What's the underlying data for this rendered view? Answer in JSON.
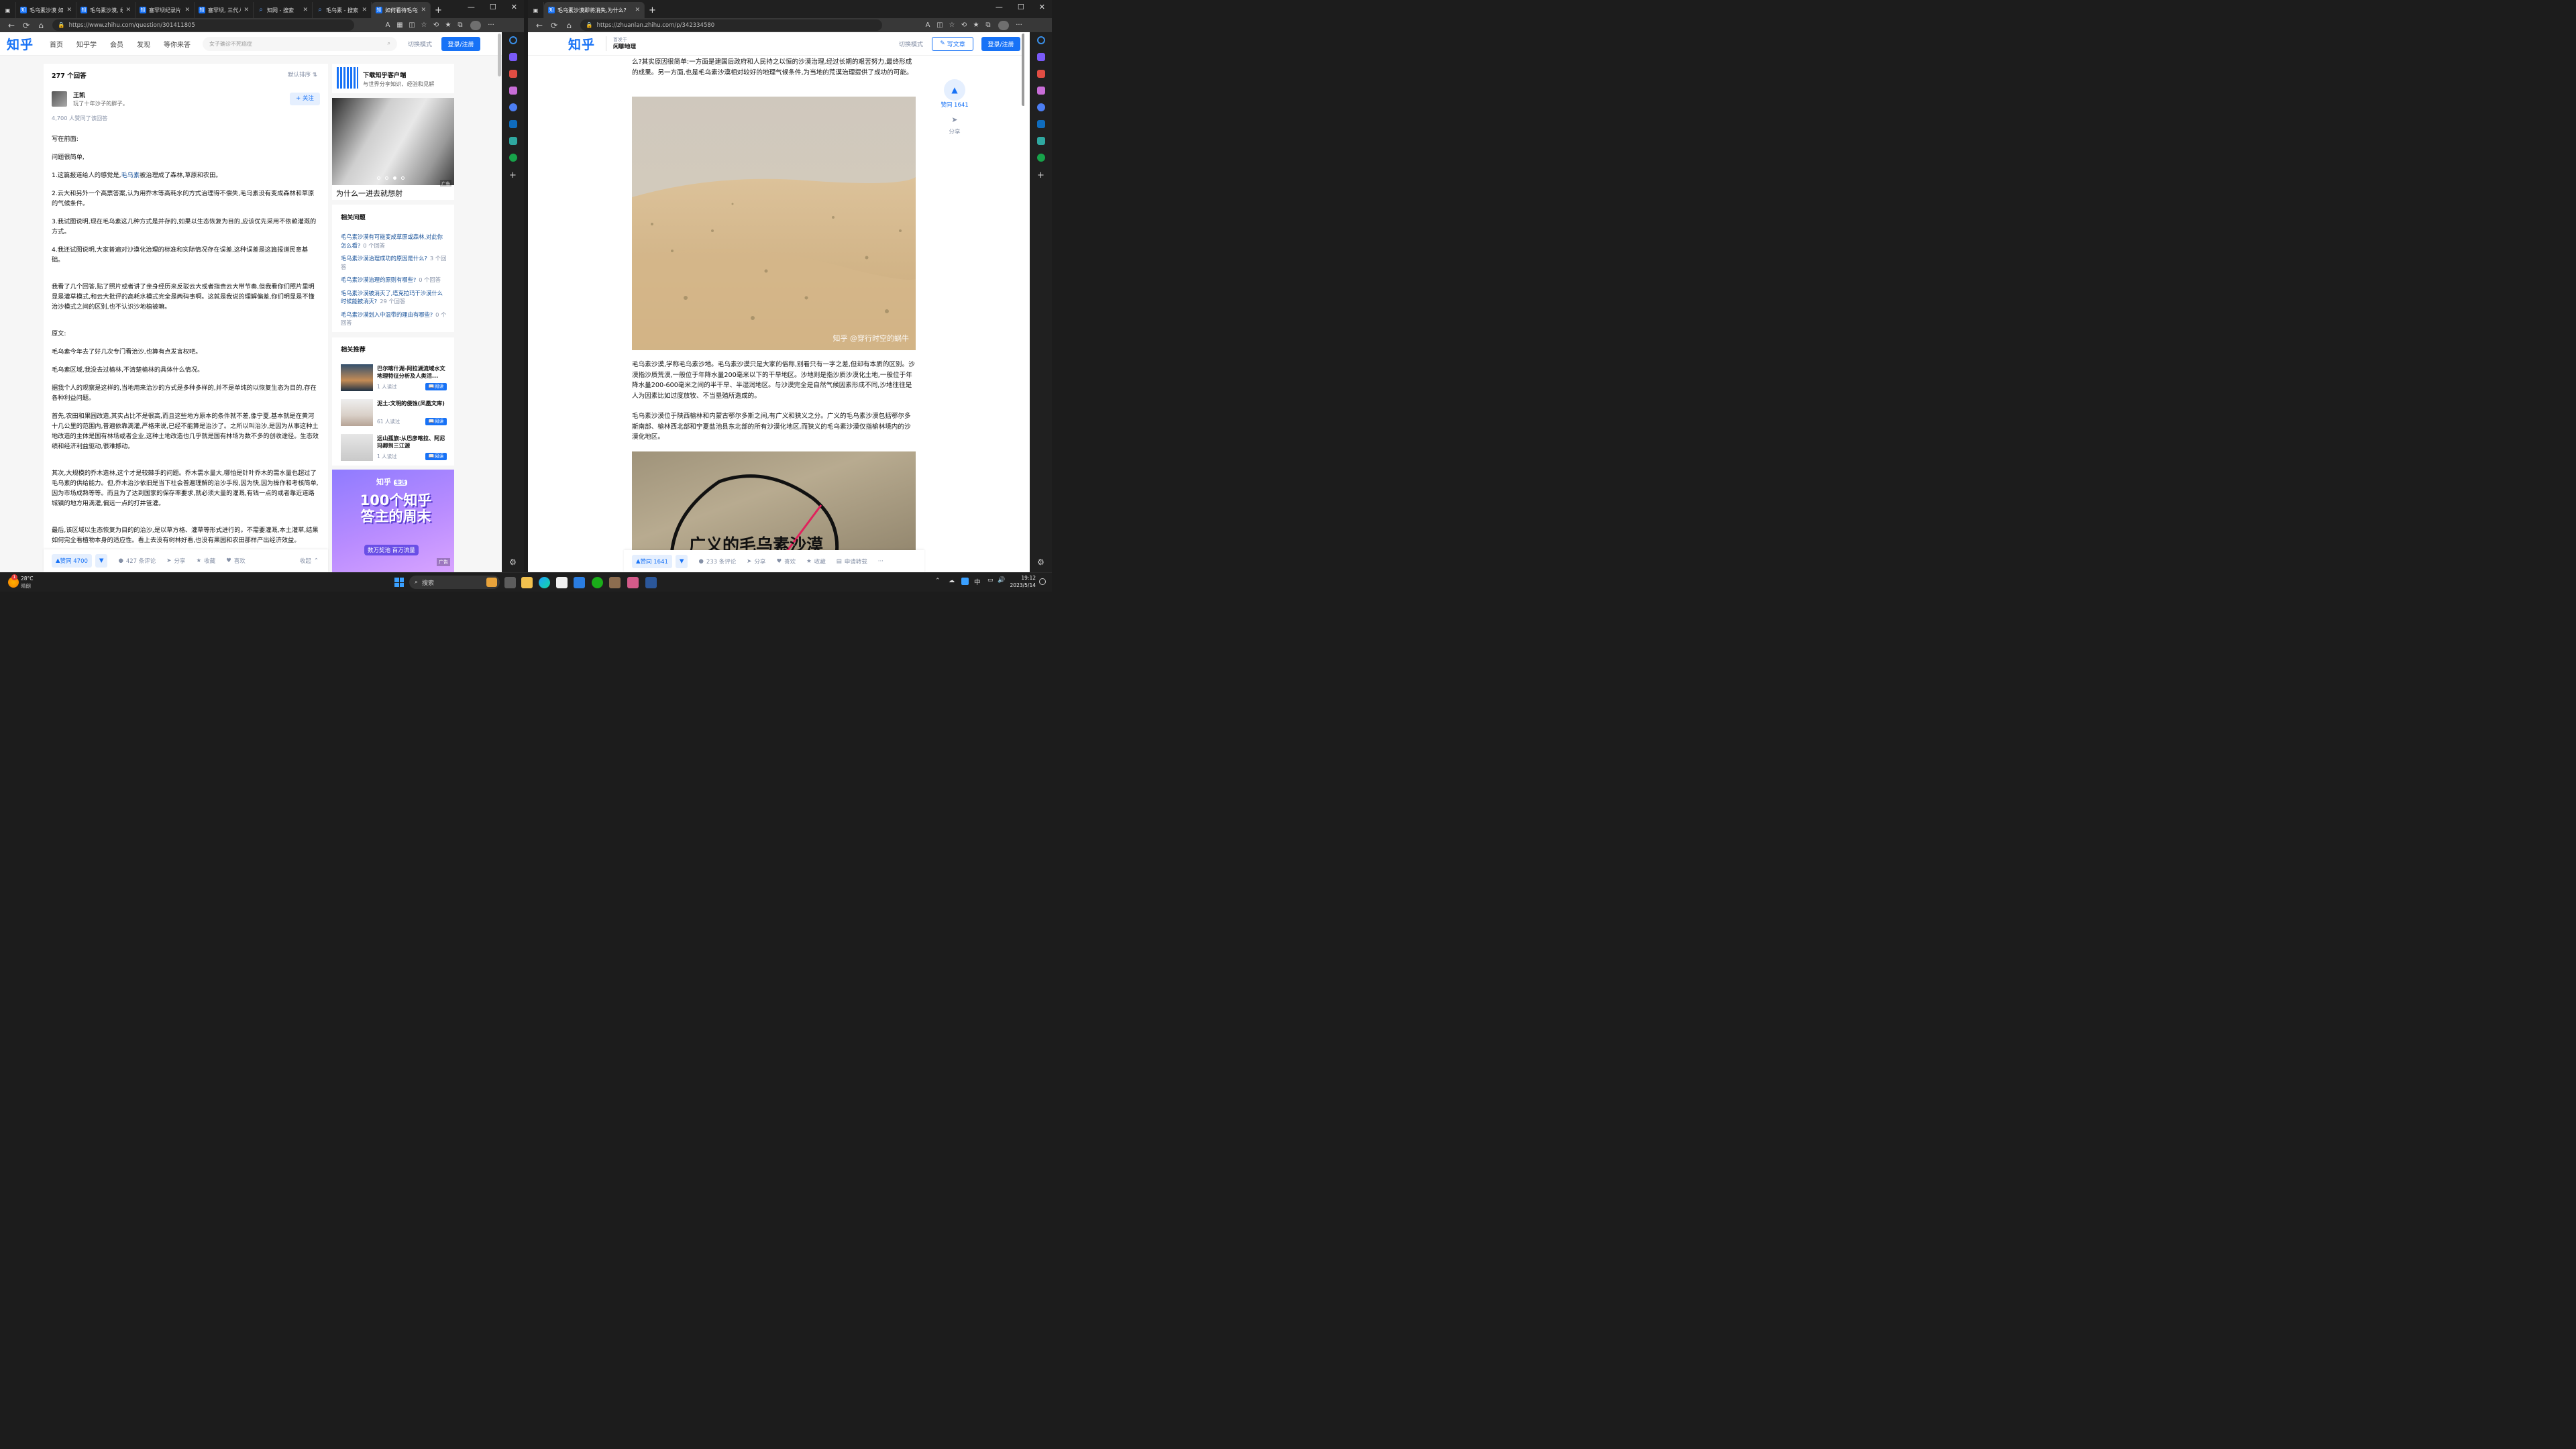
{
  "left": {
    "tabs": [
      {
        "label": "毛乌素沙漠 如何",
        "icon": "知"
      },
      {
        "label": "毛乌素沙漠, 经",
        "icon": "知"
      },
      {
        "label": "塞罕坝纪录片 -",
        "icon": "知"
      },
      {
        "label": "塞罕坝, 三代人",
        "icon": "知"
      },
      {
        "label": "知网 - 搜索",
        "icon": "search"
      },
      {
        "label": "毛乌素 - 搜索",
        "icon": "search"
      },
      {
        "label": "如何看待毛乌素",
        "icon": "知"
      }
    ],
    "url": "https://www.zhihu.com/question/301411805",
    "logo": "知乎",
    "nav": [
      "首页",
      "知乎学",
      "会员",
      "发现",
      "等你来答"
    ],
    "search_placeholder": "女子确诊不死癌症",
    "switch_mode": "切换模式",
    "login": "登录/注册",
    "answer_count": "277 个回答",
    "sort": "默认排序",
    "author": {
      "name": "王凯",
      "bio": "玩了十年沙子的胖子。",
      "follow": "关注"
    },
    "agree_line": "4,700 人赞同了该回答",
    "paragraphs": [
      {
        "text": "写在前面:"
      },
      {
        "text": "问题很简单,"
      },
      {
        "pre": "1.这篇报道给人的感觉是,",
        "link": "毛乌素",
        "post": "被治理成了森林,草原和农田。"
      },
      {
        "text": "2.云大和另外一个高票答案,认为用乔木等高耗水的方式治理得不偿失,毛乌素没有变成森林和草原的气候条件。"
      },
      {
        "text": "3.我试图说明,现在毛乌素这几种方式是并存的,如果以生态恢复为目的,应该优先采用不依赖灌溉的方式。"
      },
      {
        "text": "4.我还试图说明,大家普遍对沙漠化治理的标准和实际情况存在误差,这种误差是这篇报道民意基础。"
      },
      {
        "text": "我看了几个回答,贴了照片或者讲了亲身经历来反驳云大或者指责云大带节奏,但我看你们照片里明显是灌草模式,和云大批评的高耗水模式完全是两码事啊。这就是我说的理解偏差,你们明显是不懂治沙模式之间的区别,也不认识沙地植被嘛。"
      },
      {
        "text": "原文:"
      },
      {
        "text": "毛乌素今年去了好几次专门看治沙,也算有点发言权吧。"
      },
      {
        "text": "毛乌素区域,我没去过榆林,不清楚榆林的具体什么情况。"
      },
      {
        "text": "据我个人的观察是这样的,当地用来治沙的方式是多种多样的,并不是单纯的以恢复生态为目的,存在各种利益问题。"
      },
      {
        "text": "首先,农田和果园改造,其实占比不是很高,而且这些地方原本的条件就不差,像宁夏,基本就是在黄河十几公里的范围内,普遍依靠滴灌,严格来说,已经不能算是治沙了。之所以叫治沙,是因为从事这种土地改造的主体是国有林场或者企业,这种土地改造也几乎就是国有林场为数不多的创收途径。生态效绩和经济利益驱动,很难撼动。"
      },
      {
        "text": "其次,大规模的乔木造林,这个才是较棘手的问题。乔木需水量大,哪怕是针叶乔木的需水量也超过了毛乌素的供给能力。但,乔木治沙依旧是当下社会普遍理解的治沙手段,因为快,因为操作和考核简单,因为市场成熟等等。而且为了达到国家的保存率要求,就必须大量的灌溉,有钱一点的或者靠近道路城镇的地方用滴灌,偏远一点的打井管灌。"
      },
      {
        "text": "最后,该区域以生态恢复为目的的治沙,是以草方格、灌草等形式进行的。不需要灌溉,本土灌草,结果如何完全看植物本身的适应性。看上去没有树林好看,也没有果园和农田那样产出经济效益。"
      }
    ],
    "actions": {
      "vote": "赞同 4700",
      "comments": "427 条评论",
      "share": "分享",
      "favorite": "收藏",
      "like": "喜欢",
      "collapse": "收起"
    },
    "app_card": {
      "title": "下载知乎客户端",
      "sub": "与世界分享知识、经验和见解"
    },
    "ad_caption": "为什么一进去就想射",
    "ad_tag": "广告",
    "related_title": "相关问题",
    "related": [
      {
        "q": "毛乌素沙漠有可能变成草原或森林,对此你怎么看?",
        "n": "0 个回答"
      },
      {
        "q": "毛乌素沙漠治理成功的原因是什么?",
        "n": "3 个回答"
      },
      {
        "q": "毛乌素沙漠治理的原则有哪些?",
        "n": "0 个回答"
      },
      {
        "q": "毛乌素沙漠被消灭了,塔克拉玛干沙漠什么时候能被消灭?",
        "n": "29 个回答"
      },
      {
        "q": "毛乌素沙漠划入中温带的理由有哪些?",
        "n": "0 个回答"
      }
    ],
    "rec_title": "相关推荐",
    "recs": [
      {
        "t": "巴尔喀什湖-阿拉湖流域水文地理特征分析及人类活...",
        "c": "1 人读过",
        "r": "阅读"
      },
      {
        "t": "泥土:文明的侵蚀(凤凰文库)",
        "c": "61 人读过",
        "r": "阅读"
      },
      {
        "t": "远山孤旅:从巴彦喀拉、阿尼玛卿到三江源",
        "c": "1 人读过",
        "r": "阅读"
      }
    ],
    "promo": {
      "brand": "知乎",
      "tag": "生活",
      "big": "100个知乎答主的周末",
      "bottom": "数万奖池 百万流量",
      "ad": "广告"
    }
  },
  "right": {
    "tab_label": "毛乌素沙漠即将消失,为什么?",
    "url": "https://zhuanlan.zhihu.com/p/342334580",
    "logo": "知乎",
    "column_first": "首发于",
    "column_name": "闲聊地理",
    "switch_mode": "切换模式",
    "write": "写文章",
    "login": "登录/注册",
    "intro": "么?其实原因很简单:一方面是建国后政府和人民持之以恒的沙漠治理,经过长期的艰苦努力,最终形成的成果。另一方面,也是毛乌素沙漠相对较好的地理气候条件,为当地的荒漠治理提供了成功的可能。",
    "watermark": "知乎 @穿行时空的蜗牛",
    "para1": "毛乌素沙漠,学称毛乌素沙地。毛乌素沙漠只是大家的俗称,别看只有一字之差,但却有本质的区别。沙漠指沙质荒漠,一般位于年降水量200毫米以下的干旱地区。沙地则是指沙质沙漠化土地,一般位于年降水量200-600毫米之间的半干旱、半湿润地区。与沙漠完全是自然气候因素形成不同,沙地往往是人为因素比如过度放牧、不当垦殖所造成的。",
    "para2": "毛乌素沙漠位于陕西榆林和内蒙古鄂尔多斯之间,有广义和狭义之分。广义的毛乌素沙漠包括鄂尔多斯南部、榆林西北部和宁夏盐池县东北部的所有沙漠化地区,而狭义的毛乌素沙漠仅指榆林境内的沙漠化地区。",
    "map_label": "广义的毛乌素沙漠",
    "side_vote": "赞同 1641",
    "side_share": "分享",
    "actions": {
      "vote": "赞同 1641",
      "comments": "233 条评论",
      "share": "分享",
      "like": "喜欢",
      "favorite": "收藏",
      "repost": "申请转载",
      "more": "···"
    }
  },
  "taskbar": {
    "weather_temp": "28°C",
    "weather_desc": "晴朗",
    "search": "搜索",
    "time": "19:12",
    "date": "2023/5/14",
    "ime": "中",
    "badge": "1"
  },
  "colors": {
    "brand": "#1772f6",
    "link": "#175199",
    "muted": "#8590a6"
  }
}
